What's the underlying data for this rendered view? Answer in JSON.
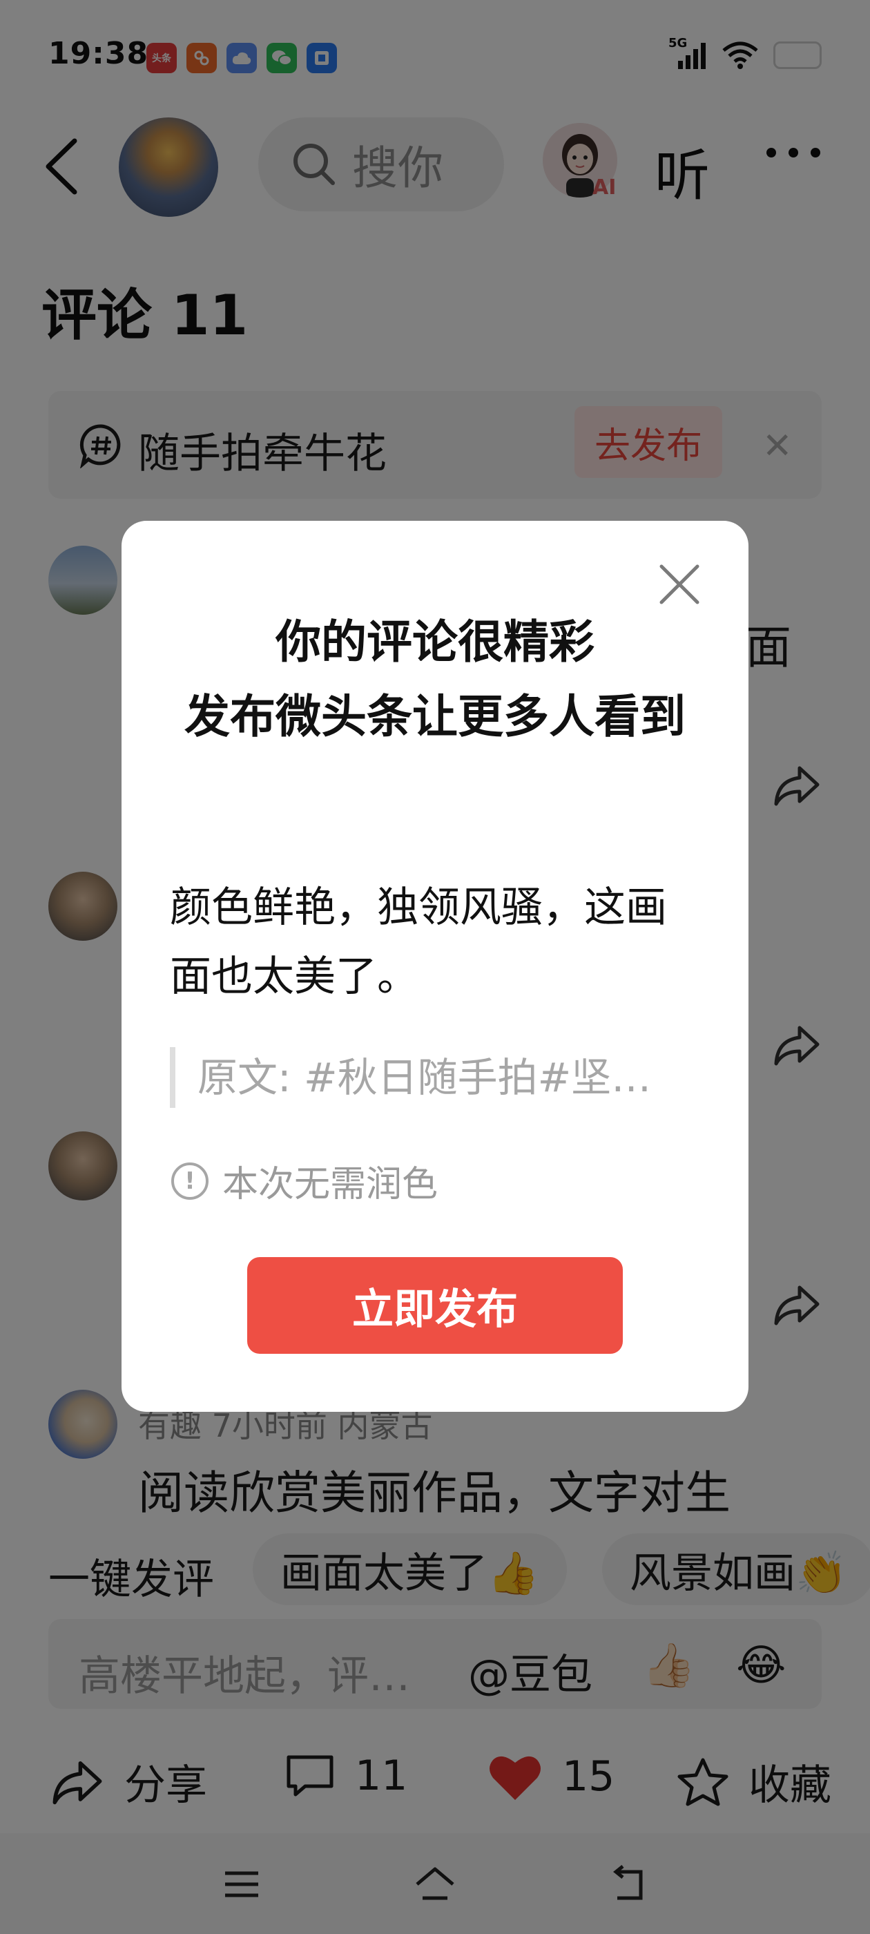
{
  "status_bar": {
    "time": "19:38",
    "network": "5G",
    "app_icons": [
      {
        "name": "toutiao-app-icon",
        "label": "头条",
        "color": "#e73c3c"
      },
      {
        "name": "shop-app-icon",
        "label": "",
        "color": "#f06b2a"
      },
      {
        "name": "cloud-app-icon",
        "label": "",
        "color": "#5d8ef2"
      },
      {
        "name": "wechat-app-icon",
        "label": "",
        "color": "#2fc05a"
      },
      {
        "name": "blue-app-icon",
        "label": "",
        "color": "#2b7bf0"
      }
    ]
  },
  "header": {
    "search_placeholder": "搜你",
    "ai_badge": "AI",
    "listen_label": "听"
  },
  "comments": {
    "title": "评论 11",
    "fragments": {
      "c1_tail": "面",
      "c4_meta": "有趣 7小时前 内蒙古",
      "c4_text": "阅读欣赏美丽作品，文字对生"
    }
  },
  "topic": {
    "text": "随手拍牵牛花",
    "post_label": "去发布",
    "close_glyph": "✕"
  },
  "quick_replies": {
    "label": "一键发评",
    "chips": [
      "画面太美了👍",
      "风景如画👏"
    ]
  },
  "input_bar": {
    "placeholder": "高楼平地起，评…",
    "mention": "@豆包",
    "emojis": [
      "👍🏻",
      "😂"
    ]
  },
  "actions": {
    "share": "分享",
    "comments_count": "11",
    "likes_count": "15",
    "favorite": "收藏"
  },
  "modal": {
    "title_line1": "你的评论很精彩",
    "title_line2": "发布微头条让更多人看到",
    "comment_text": "颜色鲜艳，独领风骚，这画面也太美了。",
    "quote": "原文: #秋日随手拍#坚…",
    "hint": "本次无需润色",
    "publish_label": "立即发布"
  },
  "colors": {
    "accent": "#ee4f44",
    "like_red": "#e8322f",
    "overlay": "rgba(0,0,0,0.5)"
  }
}
